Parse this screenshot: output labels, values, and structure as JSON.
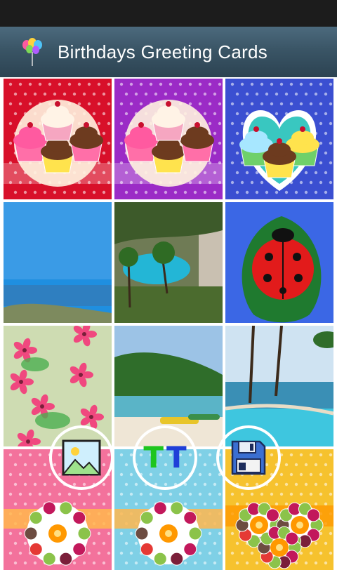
{
  "app": {
    "title": "Birthdays Greeting Cards",
    "icon": "balloons-icon"
  },
  "cards": [
    {
      "name": "card-cupcakes-red",
      "theme": "cupcakes",
      "bg": "#d8102a"
    },
    {
      "name": "card-cupcakes-purple",
      "theme": "cupcakes",
      "bg": "#9b2bc6"
    },
    {
      "name": "card-cupcakes-heart-blue",
      "theme": "cupcakes-heart",
      "bg": "#3b4fd1"
    },
    {
      "name": "card-photo-sea",
      "theme": "photo-sea"
    },
    {
      "name": "card-photo-pool-resort",
      "theme": "photo-resort"
    },
    {
      "name": "card-ladybug",
      "theme": "ladybug"
    },
    {
      "name": "card-pink-flowers",
      "theme": "flowers"
    },
    {
      "name": "card-photo-beach",
      "theme": "photo-beach"
    },
    {
      "name": "card-photo-pool-palms",
      "theme": "photo-pool"
    },
    {
      "name": "card-fruit-pink",
      "theme": "fruit",
      "bg": "#f3729c"
    },
    {
      "name": "card-fruit-blue",
      "theme": "fruit",
      "bg": "#7fd0e6"
    },
    {
      "name": "card-fruit-heart-yellow",
      "theme": "fruit-heart",
      "bg": "#f6c22e"
    }
  ],
  "actions": [
    {
      "name": "image-button",
      "icon": "image-icon"
    },
    {
      "name": "text-button",
      "icon": "text-tt-icon",
      "glyph_1": "T",
      "glyph_2": "T"
    },
    {
      "name": "save-button",
      "icon": "floppy-disk-icon"
    }
  ]
}
